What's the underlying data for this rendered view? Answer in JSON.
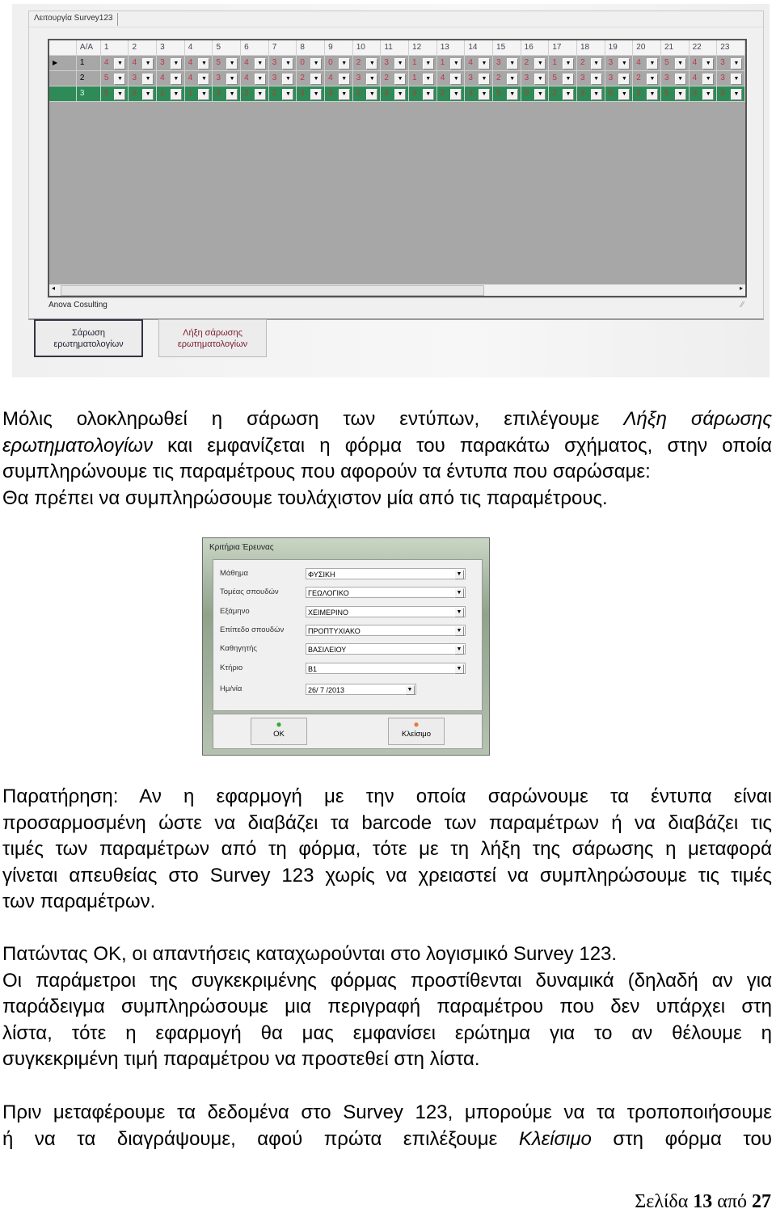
{
  "app": {
    "tab_label": "Λειτουργία Survey123",
    "grid": {
      "headers": [
        "A/A",
        "1",
        "2",
        "3",
        "4",
        "5",
        "6",
        "7",
        "8",
        "9",
        "10",
        "11",
        "12",
        "13",
        "14",
        "15",
        "16",
        "17",
        "18",
        "19",
        "20",
        "21",
        "22",
        "23"
      ],
      "rows": [
        {
          "aa": "1",
          "current": true,
          "selected": false,
          "values": [
            "4",
            "4",
            "3",
            "4",
            "5",
            "4",
            "3",
            "0",
            "0",
            "2",
            "3",
            "1",
            "1",
            "4",
            "3",
            "2",
            "1",
            "2",
            "3",
            "4",
            "5",
            "4",
            "3"
          ]
        },
        {
          "aa": "2",
          "current": false,
          "selected": false,
          "values": [
            "5",
            "3",
            "4",
            "4",
            "3",
            "4",
            "3",
            "2",
            "4",
            "3",
            "2",
            "1",
            "4",
            "3",
            "2",
            "3",
            "5",
            "3",
            "3",
            "2",
            "3",
            "4",
            "3"
          ]
        },
        {
          "aa": "3",
          "current": false,
          "selected": true,
          "values": [
            "5",
            "3",
            "1",
            "1",
            "3",
            "2",
            "2",
            "4",
            "3",
            "2",
            "4",
            "3",
            "2",
            "3",
            "5",
            "0",
            "2",
            "3",
            "0",
            "2",
            "5",
            "3",
            "3"
          ]
        }
      ],
      "selected_row_color": "#2e8b57",
      "value_color": "#c0364a"
    },
    "status_text": "Anova Cosulting",
    "scan_button": "Σάρωση ερωτηματολογίων",
    "end_scan_button": "Λήξη σάρωσης ερωτηματολογίων"
  },
  "paragraphs": [
    [
      {
        "j": true,
        "segs": [
          {
            "t": "Μόλις ολοκληρωθεί η σάρωση των εντύπων, επιλέγουμε "
          },
          {
            "t": "Λήξη σάρωσης",
            "i": true
          }
        ]
      },
      {
        "j": true,
        "segs": [
          {
            "t": "ερωτηματολογίων",
            "i": true
          },
          {
            "t": " και εμφανίζεται η φόρμα του παρακάτω σχήματος, στην οποία"
          }
        ]
      },
      {
        "j": false,
        "segs": [
          {
            "t": "συμπληρώνουμε τις παραμέτρους που αφορούν τα έντυπα που σαρώσαμε:"
          }
        ]
      },
      {
        "j": false,
        "segs": [
          {
            "t": "Θα πρέπει να συμπληρώσουμε τουλάχιστον μία από τις παραμέτρους."
          }
        ]
      }
    ],
    [
      {
        "j": true,
        "segs": [
          {
            "t": "Παρατήρηση: Αν η εφαρμογή με την οποία σαρώνουμε τα έντυπα είναι"
          }
        ]
      },
      {
        "j": true,
        "segs": [
          {
            "t": "προσαρμοσμένη ώστε να διαβάζει τα barcode των παραμέτρων ή να διαβάζει τις"
          }
        ]
      },
      {
        "j": true,
        "segs": [
          {
            "t": "τιμές των παραμέτρων από τη φόρμα, τότε με τη λήξη της σάρωσης η μεταφορά"
          }
        ]
      },
      {
        "j": true,
        "segs": [
          {
            "t": "γίνεται απευθείας στο Survey 123 χωρίς να χρειαστεί να συμπληρώσουμε τις τιμές"
          }
        ]
      },
      {
        "j": false,
        "segs": [
          {
            "t": "των παραμέτρων."
          }
        ]
      }
    ],
    [
      {
        "j": false,
        "segs": [
          {
            "t": "Πατώντας OK, οι απαντήσεις καταχωρούνται στο λογισμικό Survey 123."
          }
        ]
      },
      {
        "j": true,
        "segs": [
          {
            "t": "Οι παράμετροι της συγκεκριμένης φόρμας προστίθενται δυναμικά (δηλαδή αν για"
          }
        ]
      },
      {
        "j": true,
        "segs": [
          {
            "t": "παράδειγμα συμπληρώσουμε μια περιγραφή παραμέτρου που δεν υπάρχει στη"
          }
        ]
      },
      {
        "j": true,
        "segs": [
          {
            "t": "λίστα, τότε η εφαρμογή θα μας εμφανίσει ερώτημα για το αν θέλουμε η"
          }
        ]
      },
      {
        "j": false,
        "segs": [
          {
            "t": "συγκεκριμένη τιμή παραμέτρου να προστεθεί στη λίστα."
          }
        ]
      }
    ],
    [
      {
        "j": true,
        "segs": [
          {
            "t": "Πριν μεταφέρουμε τα δεδομένα στο Survey 123, μπορούμε να τα τροποποιήσουμε"
          }
        ]
      },
      {
        "j": true,
        "segs": [
          {
            "t": "ή να τα διαγράψουμε, αφού πρώτα επιλέξουμε "
          },
          {
            "t": "Κλείσιμο",
            "i": true
          },
          {
            "t": " στη φόρμα του"
          }
        ]
      }
    ]
  ],
  "dialog": {
    "title": "Κριτήρια Έρευνας",
    "fields": [
      {
        "label": "Μάθημα",
        "value": "ΦΥΣΙΚΗ"
      },
      {
        "label": "Τομέας σπουδών",
        "value": "ΓΕΩΛΟΓΙΚΟ"
      },
      {
        "label": "Εξάμηνο",
        "value": "ΧΕΙΜΕΡΙΝΟ"
      },
      {
        "label": "Επίπεδο σπουδών",
        "value": "ΠΡΟΠΤΥΧΙΑΚΟ"
      },
      {
        "label": "Καθηγητής",
        "value": "ΒΑΣΙΛΕΙΟΥ"
      },
      {
        "label": "Κτήριο",
        "value": "Β1"
      },
      {
        "label": "Ημ/νία",
        "value": "26/ 7 /2013"
      }
    ],
    "ok_label": "OK",
    "close_label": "Κλείσιμο"
  },
  "footer": {
    "prefix": "Σελίδα",
    "page": "13",
    "of": "από",
    "total": "27"
  }
}
